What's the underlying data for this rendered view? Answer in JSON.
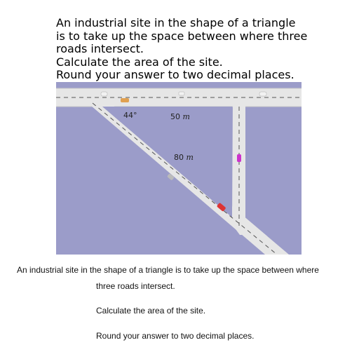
{
  "heading_lines": [
    "An industrial site in the shape of a triangle",
    "is to take up the space between where three",
    "roads intersect.",
    "Calculate the area of the site.",
    "Round your answer to two decimal places."
  ],
  "figure": {
    "angle_label": "44°",
    "side_a_value": "50",
    "side_a_unit": "m",
    "side_b_value": "80",
    "side_b_unit": "m",
    "colors": {
      "land": "#9b9cc9",
      "road": "#e6e6e6",
      "road_edge": "#c9c9c9",
      "marking": "#555555"
    }
  },
  "body_lines": [
    "An industrial site in the shape of a triangle is to take up the space between where",
    "three roads intersect.",
    "Calculate the area of the site.",
    "Round your answer to two decimal places."
  ]
}
